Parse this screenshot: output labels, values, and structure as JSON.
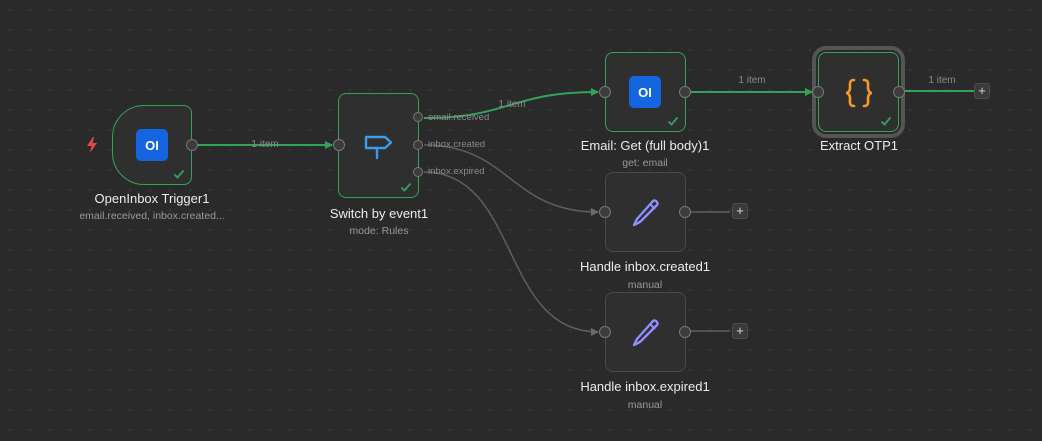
{
  "colors": {
    "canvas_bg": "#2a2a2a",
    "success": "#34a35a",
    "edge_idle": "#5f5f5f",
    "openinbox_brand": "#1565e0",
    "switch_icon": "#3d9be9",
    "code_icon": "#f39a2b",
    "pencil_icon": "#8f8cff",
    "trigger_bolt": "#e04b4b"
  },
  "nodes": {
    "trigger": {
      "title": "OpenInbox Trigger1",
      "subtitle": "email.received, inbox.created...",
      "icon_text": "OI",
      "icon": "openinbox-logo",
      "bolt_icon": "lightning-bolt-icon",
      "status": "success"
    },
    "switch": {
      "title": "Switch by event1",
      "subtitle": "mode: Rules",
      "icon": "signpost-icon",
      "status": "success",
      "outputs": [
        "email.received",
        "inbox.created",
        "inbox.expired"
      ]
    },
    "email_get": {
      "title": "Email: Get (full body)1",
      "subtitle": "get: email",
      "icon_text": "OI",
      "icon": "openinbox-logo",
      "status": "success"
    },
    "extract_otp": {
      "title": "Extract OTP1",
      "subtitle": "",
      "icon": "curly-braces-icon",
      "status": "success",
      "selected": true
    },
    "handle_created": {
      "title": "Handle inbox.created1",
      "subtitle": "manual",
      "icon": "pencil-icon",
      "status": "idle"
    },
    "handle_expired": {
      "title": "Handle inbox.expired1",
      "subtitle": "manual",
      "icon": "pencil-icon",
      "status": "idle"
    }
  },
  "edges": {
    "trigger_to_switch": "1 item",
    "switch_to_email": "1 item",
    "email_to_extract": "1 item",
    "extract_out": "1 item"
  },
  "add_button_label": "+"
}
